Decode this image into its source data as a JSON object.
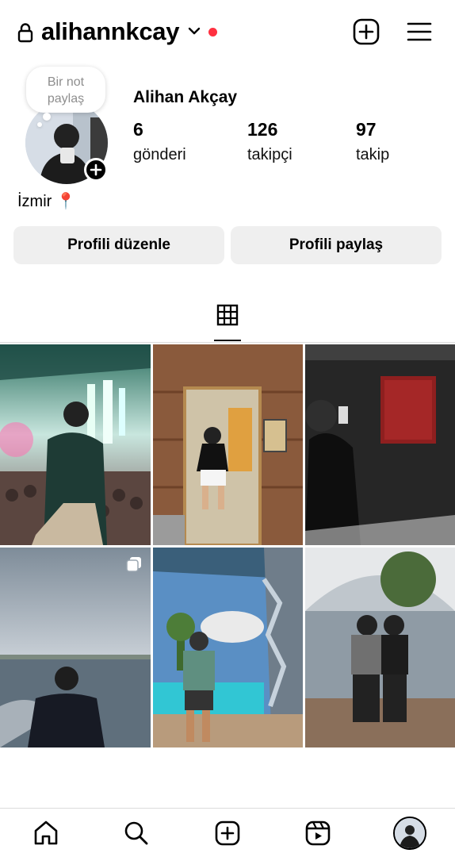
{
  "header": {
    "username": "alihannkcay",
    "lock_icon": "lock-icon",
    "dropdown_icon": "chevron-down-icon",
    "notification_dot_color": "#ff3040",
    "create_icon": "plus-square-icon",
    "menu_icon": "hamburger-menu-icon"
  },
  "note": {
    "line1": "Bir not",
    "line2": "paylaş"
  },
  "profile": {
    "full_name": "Alihan Akçay",
    "bio": "İzmir 📍",
    "stats": {
      "posts": {
        "value": "6",
        "label": "gönderi"
      },
      "followers": {
        "value": "126",
        "label": "takipçi"
      },
      "following": {
        "value": "97",
        "label": "takip"
      }
    }
  },
  "actions": {
    "edit_profile": "Profili düzenle",
    "share_profile": "Profili paylaş"
  },
  "tabs": {
    "active": "grid-icon"
  },
  "posts": [
    {
      "name": "post-1",
      "description": "club-crowd-photo"
    },
    {
      "name": "post-2",
      "description": "mirror-selfie-wood-wall"
    },
    {
      "name": "post-3",
      "description": "dark-mirror-selfie"
    },
    {
      "name": "post-4",
      "description": "boat-sea-photo",
      "multiple": true
    },
    {
      "name": "post-5",
      "description": "pool-mirror-photo"
    },
    {
      "name": "post-6",
      "description": "two-men-cafe-photo"
    }
  ],
  "bottom_nav": {
    "items": [
      "home-icon",
      "search-icon",
      "create-icon",
      "reels-icon",
      "profile-avatar"
    ]
  }
}
